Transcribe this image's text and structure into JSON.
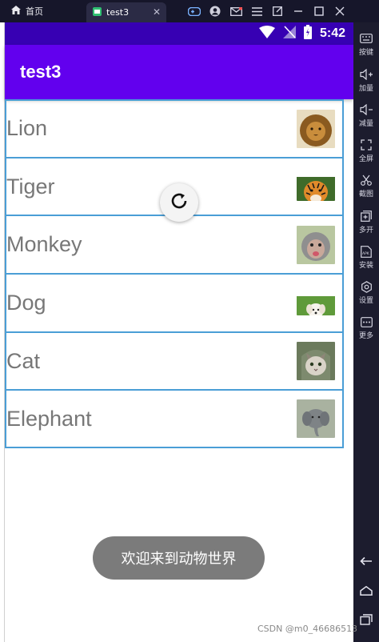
{
  "window": {
    "tabs": [
      {
        "label": "首页",
        "icon": "home-icon"
      },
      {
        "label": "test3",
        "icon": "app-icon",
        "close": "✕"
      }
    ],
    "toolbar_icons": [
      "gamepad-icon",
      "account-icon",
      "mail-icon",
      "menu-icon",
      "popout-icon",
      "minimize-icon",
      "maximize-icon",
      "close-icon"
    ]
  },
  "status_bar": {
    "time": "5:42",
    "icons": [
      "wifi-icon",
      "signal-icon",
      "battery-icon"
    ]
  },
  "app_bar": {
    "title": "test3",
    "color": "#6200ee",
    "status_color": "#3700b3"
  },
  "animals": [
    {
      "name": "Lion",
      "image": "lion-image"
    },
    {
      "name": "Tiger",
      "image": "tiger-image"
    },
    {
      "name": "Monkey",
      "image": "monkey-image"
    },
    {
      "name": "Dog",
      "image": "dog-image"
    },
    {
      "name": "Cat",
      "image": "cat-image"
    },
    {
      "name": "Elephant",
      "image": "elephant-image"
    }
  ],
  "refresh": {
    "icon": "refresh-icon"
  },
  "toast": {
    "text": "欢迎来到动物世界"
  },
  "sidebar": {
    "items": [
      {
        "label": "按键",
        "icon": "keyboard-icon"
      },
      {
        "label": "加量",
        "icon": "volume-up-icon"
      },
      {
        "label": "减量",
        "icon": "volume-down-icon"
      },
      {
        "label": "全屏",
        "icon": "fullscreen-icon"
      },
      {
        "label": "截图",
        "icon": "scissors-icon"
      },
      {
        "label": "多开",
        "icon": "multi-open-icon"
      },
      {
        "label": "安装",
        "icon": "apk-icon"
      },
      {
        "label": "设置",
        "icon": "gear-icon"
      },
      {
        "label": "更多",
        "icon": "more-icon"
      }
    ],
    "nav": [
      "back-icon",
      "home-icon",
      "recents-icon"
    ]
  },
  "watermark": "CSDN @m0_46686513"
}
